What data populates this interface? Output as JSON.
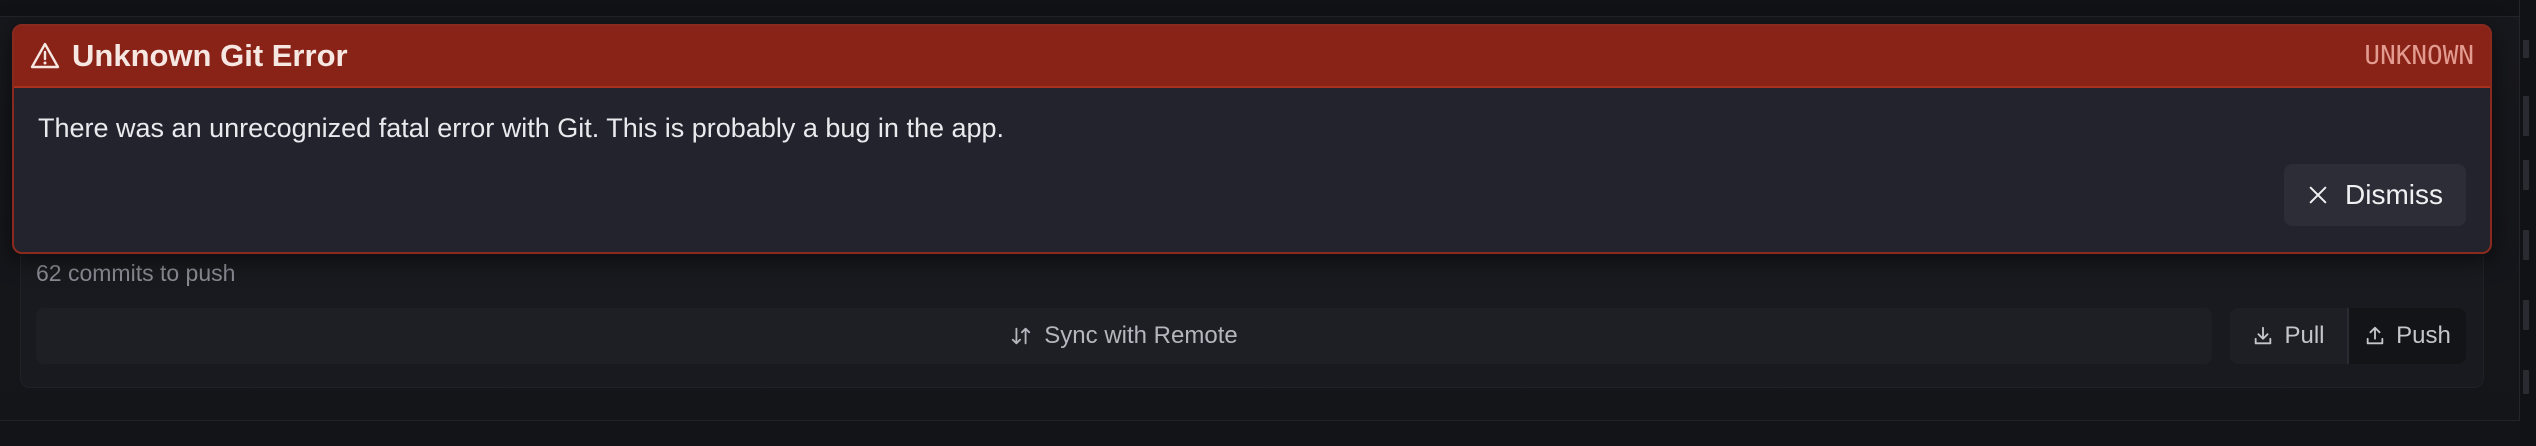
{
  "error": {
    "title": "Unknown Git Error",
    "code": "UNKNOWN",
    "message": "There was an unrecognized fatal error with Git. This is probably a bug in the app.",
    "dismiss_label": "Dismiss",
    "icon": "warning-triangle-icon",
    "accent_color": "#892317"
  },
  "sync": {
    "commits_status": "62 commits to push",
    "sync_label": "Sync with Remote",
    "sync_icon": "sort-arrows-icon",
    "pull_label": "Pull",
    "pull_icon": "download-icon",
    "push_label": "Push",
    "push_icon": "upload-icon"
  }
}
